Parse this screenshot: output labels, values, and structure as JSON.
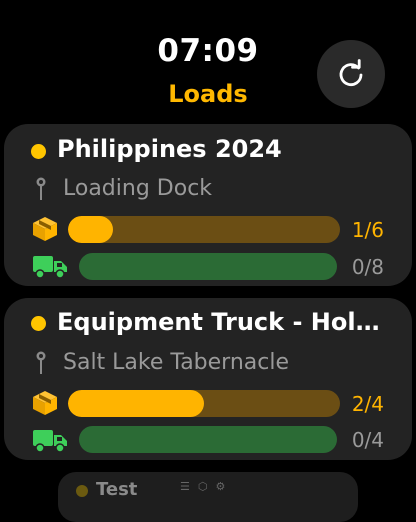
{
  "status": {
    "time": "07:09"
  },
  "header": {
    "title": "Loads"
  },
  "loads": [
    {
      "name": "Philippines 2024",
      "location": "Loading Dock",
      "boxes": {
        "label": "1/6",
        "progress": 0.1667
      },
      "trucks": {
        "label": "0/8",
        "progress": 0
      }
    },
    {
      "name": "Equipment Truck - Hol…",
      "location": "Salt Lake Tabernacle",
      "boxes": {
        "label": "2/4",
        "progress": 0.5
      },
      "trucks": {
        "label": "0/4",
        "progress": 0
      }
    },
    {
      "name": "Test"
    }
  ],
  "colors": {
    "accent": "#FFB800",
    "status_dot": "#FFC500",
    "truck_green": "#3ecf5a"
  },
  "icons": [
    "refresh-icon",
    "pin-icon",
    "box-icon",
    "truck-icon"
  ]
}
